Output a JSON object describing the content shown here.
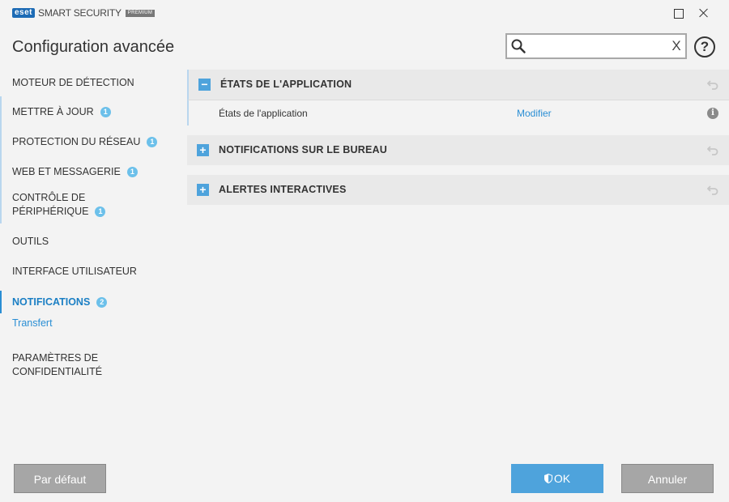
{
  "app": {
    "logo_badge": "eset",
    "product": "SMART SECURITY",
    "edition": "PREMIUM"
  },
  "header": {
    "title": "Configuration avancée",
    "search_value": "",
    "clear_glyph": "X",
    "help_glyph": "?"
  },
  "sidebar": {
    "items": [
      {
        "label": "MOTEUR DE DÉTECTION",
        "badge": ""
      },
      {
        "label": "METTRE À JOUR",
        "badge": "1"
      },
      {
        "label": "PROTECTION DU RÉSEAU",
        "badge": "1"
      },
      {
        "label": "WEB ET MESSAGERIE",
        "badge": "1"
      },
      {
        "label_line1": "CONTRÔLE DE",
        "label_line2": "PÉRIPHÉRIQUE",
        "badge": "1"
      },
      {
        "label": "OUTILS",
        "badge": ""
      },
      {
        "label": "INTERFACE UTILISATEUR",
        "badge": ""
      },
      {
        "label": "NOTIFICATIONS",
        "badge": "2"
      },
      {
        "label_line1": "PARAMÈTRES DE",
        "label_line2": "CONFIDENTIALITÉ",
        "badge": ""
      }
    ],
    "sub_item": "Transfert"
  },
  "sections": [
    {
      "title": "ÉTATS DE L'APPLICATION",
      "toggle": "−",
      "rows": [
        {
          "label": "États de l'application",
          "link": "Modifier",
          "info": "i"
        }
      ]
    },
    {
      "title": "NOTIFICATIONS SUR LE BUREAU",
      "toggle": "+"
    },
    {
      "title": "ALERTES INTERACTIVES",
      "toggle": "+"
    }
  ],
  "footer": {
    "default_label": "Par défaut",
    "ok_label": "OK",
    "cancel_label": "Annuler"
  },
  "colors": {
    "accent": "#4ea3dc",
    "link": "#2a8ed4",
    "badge": "#6cc0ea"
  },
  "icons": {
    "search": "magnifier",
    "revert": "undo-arrow",
    "ok": "shield"
  }
}
